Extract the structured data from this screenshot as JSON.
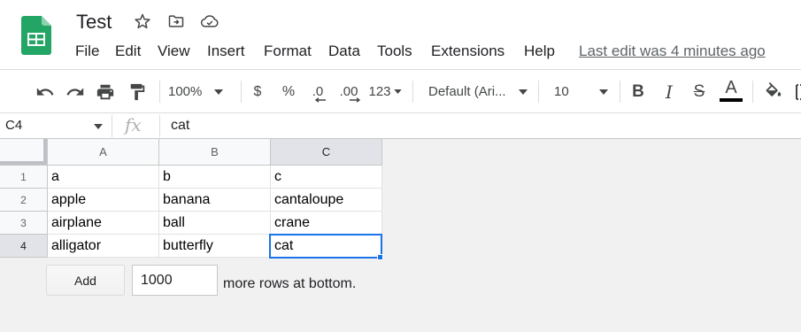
{
  "header": {
    "title": "Test",
    "title_icons": [
      "star-icon",
      "move-folder-icon",
      "cloud-status-icon"
    ],
    "menu": [
      "File",
      "Edit",
      "View",
      "Insert",
      "Format",
      "Data",
      "Tools",
      "Extensions",
      "Help"
    ],
    "last_edit": "Last edit was 4 minutes ago",
    "brand_color": "#0f9d58"
  },
  "toolbar": {
    "zoom": "100%",
    "currency": "$",
    "percent": "%",
    "decrease_decimal": ".0",
    "increase_decimal": ".00",
    "more_formats": "123",
    "font": "Default (Ari...",
    "font_size": "10",
    "bold": "B",
    "italic": "I",
    "strike": "S",
    "text_color": "A",
    "icons": [
      "undo-icon",
      "redo-icon",
      "print-icon",
      "paint-format-icon",
      "fill-color-icon",
      "borders-icon"
    ]
  },
  "formula_bar": {
    "name_box": "C4",
    "fx": "fx",
    "value": "cat"
  },
  "grid": {
    "columns": [
      "A",
      "B",
      "C"
    ],
    "selected_column": "C",
    "rows": [
      {
        "num": "1",
        "cells": [
          "a",
          "b",
          "c"
        ]
      },
      {
        "num": "2",
        "cells": [
          "apple",
          "banana",
          "cantaloupe"
        ]
      },
      {
        "num": "3",
        "cells": [
          "airplane",
          "ball",
          "crane"
        ]
      },
      {
        "num": "4",
        "cells": [
          "alligator",
          "butterfly",
          "cat"
        ]
      }
    ],
    "selected_row": "4",
    "selection_color": "#1a73e8"
  },
  "add_rows": {
    "button": "Add",
    "count": "1000",
    "label": "more rows at bottom."
  }
}
